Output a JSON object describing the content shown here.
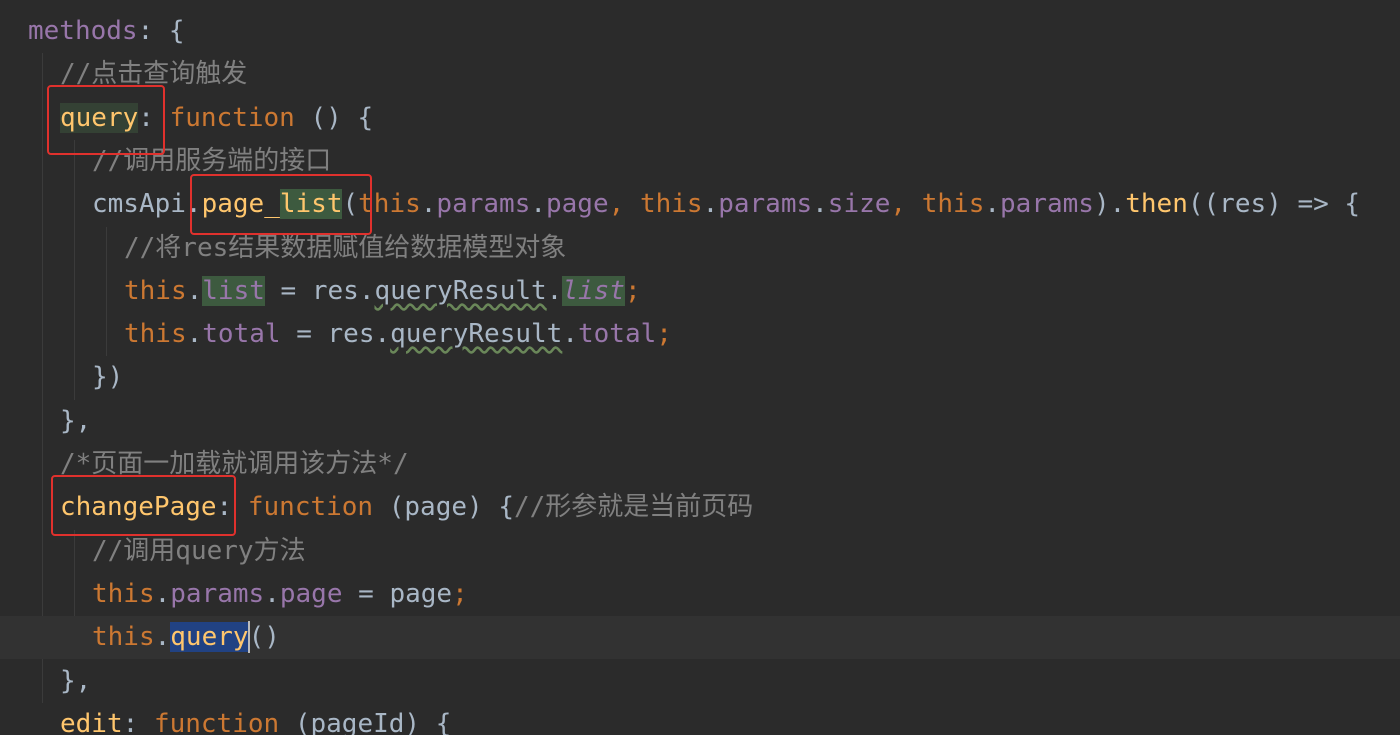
{
  "lines": [
    {
      "indent": 1,
      "tokens": [
        {
          "t": "methods",
          "c": "prop"
        },
        {
          "t": ": {",
          "c": "plain"
        }
      ]
    },
    {
      "indent": 2,
      "tokens": [
        {
          "t": "//点击查询触发",
          "c": "cm"
        }
      ]
    },
    {
      "indent": 2,
      "tokens": [
        {
          "t": "query",
          "c": "fn hl-green"
        },
        {
          "t": ": ",
          "c": "plain"
        },
        {
          "t": "function",
          "c": "kw"
        },
        {
          "t": " () {",
          "c": "plain"
        }
      ]
    },
    {
      "indent": 3,
      "tokens": [
        {
          "t": "//调用服务端的接口",
          "c": "cm"
        }
      ]
    },
    {
      "indent": 3,
      "tokens": [
        {
          "t": "cmsApi.",
          "c": "plain"
        },
        {
          "t": "page_",
          "c": "fn"
        },
        {
          "t": "list",
          "c": "fn hl-green2"
        },
        {
          "t": "(",
          "c": "plain"
        },
        {
          "t": "this",
          "c": "kw"
        },
        {
          "t": ".",
          "c": "plain"
        },
        {
          "t": "params",
          "c": "prop"
        },
        {
          "t": ".",
          "c": "plain"
        },
        {
          "t": "page",
          "c": "prop"
        },
        {
          "t": ", ",
          "c": "kw"
        },
        {
          "t": "this",
          "c": "kw"
        },
        {
          "t": ".",
          "c": "plain"
        },
        {
          "t": "params",
          "c": "prop"
        },
        {
          "t": ".",
          "c": "plain"
        },
        {
          "t": "size",
          "c": "prop"
        },
        {
          "t": ", ",
          "c": "kw"
        },
        {
          "t": "this",
          "c": "kw"
        },
        {
          "t": ".",
          "c": "plain"
        },
        {
          "t": "params",
          "c": "prop"
        },
        {
          "t": ").",
          "c": "plain"
        },
        {
          "t": "then",
          "c": "fn"
        },
        {
          "t": "((res) => {",
          "c": "plain"
        }
      ]
    },
    {
      "indent": 4,
      "tokens": [
        {
          "t": "//将res结果数据赋值给数据模型对象",
          "c": "cm"
        }
      ]
    },
    {
      "indent": 4,
      "tokens": [
        {
          "t": "this",
          "c": "kw"
        },
        {
          "t": ".",
          "c": "plain"
        },
        {
          "t": "list",
          "c": "prop hl-green2"
        },
        {
          "t": " = res.",
          "c": "plain"
        },
        {
          "t": "queryResult",
          "c": "plain wavy"
        },
        {
          "t": ".",
          "c": "plain"
        },
        {
          "t": "list",
          "c": "prop italic hl-green2"
        },
        {
          "t": ";",
          "c": "kw"
        }
      ]
    },
    {
      "indent": 4,
      "tokens": [
        {
          "t": "this",
          "c": "kw"
        },
        {
          "t": ".",
          "c": "plain"
        },
        {
          "t": "total",
          "c": "prop"
        },
        {
          "t": " = res.",
          "c": "plain"
        },
        {
          "t": "queryResult",
          "c": "plain wavy"
        },
        {
          "t": ".",
          "c": "plain"
        },
        {
          "t": "total",
          "c": "prop"
        },
        {
          "t": ";",
          "c": "kw"
        }
      ]
    },
    {
      "indent": 3,
      "tokens": [
        {
          "t": "})",
          "c": "plain"
        }
      ]
    },
    {
      "indent": 2,
      "tokens": [
        {
          "t": "},",
          "c": "plain"
        }
      ]
    },
    {
      "indent": 2,
      "tokens": [
        {
          "t": "/*页面一加载就调用该方法*/",
          "c": "cm"
        }
      ]
    },
    {
      "indent": 2,
      "tokens": [
        {
          "t": "changePage",
          "c": "fn"
        },
        {
          "t": ": ",
          "c": "plain"
        },
        {
          "t": "function",
          "c": "kw"
        },
        {
          "t": " (page) {",
          "c": "plain"
        },
        {
          "t": "//形参就是当前页码",
          "c": "cm"
        }
      ]
    },
    {
      "indent": 3,
      "tokens": [
        {
          "t": "//调用query方法",
          "c": "cm"
        }
      ]
    },
    {
      "indent": 3,
      "tokens": [
        {
          "t": "this",
          "c": "kw"
        },
        {
          "t": ".",
          "c": "plain"
        },
        {
          "t": "params",
          "c": "prop"
        },
        {
          "t": ".",
          "c": "plain"
        },
        {
          "t": "page",
          "c": "prop"
        },
        {
          "t": " = page",
          "c": "plain"
        },
        {
          "t": ";",
          "c": "kw"
        }
      ]
    },
    {
      "indent": 3,
      "current": true,
      "tokens": [
        {
          "t": "this",
          "c": "kw"
        },
        {
          "t": ".",
          "c": "plain"
        },
        {
          "t": "query",
          "c": "fn hl-sel"
        },
        {
          "t": "()",
          "c": "plain"
        }
      ]
    },
    {
      "indent": 2,
      "tokens": [
        {
          "t": "},",
          "c": "plain"
        }
      ]
    },
    {
      "indent": 2,
      "tokens": [
        {
          "t": "edit",
          "c": "fn"
        },
        {
          "t": ": ",
          "c": "plain"
        },
        {
          "t": "function",
          "c": "kw"
        },
        {
          "t": " (pageId) {",
          "c": "plain"
        }
      ]
    }
  ],
  "colors": {
    "background": "#2b2b2b",
    "keyword": "#cc7832",
    "function": "#ffc66d",
    "property": "#9876aa",
    "comment": "#808080",
    "annotation_box": "#e0312d"
  }
}
